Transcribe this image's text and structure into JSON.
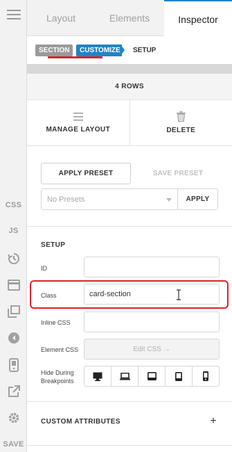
{
  "rail": {
    "css_label": "CSS",
    "js_label": "JS",
    "save_label": "SAVE"
  },
  "tabs": [
    {
      "label": "Layout",
      "active": false
    },
    {
      "label": "Elements",
      "active": false
    },
    {
      "label": "Inspector",
      "active": true
    }
  ],
  "breadcrumb": {
    "section": "SECTION",
    "customize": "CUSTOMIZE",
    "setup": "SETUP"
  },
  "rows_label": "4 ROWS",
  "actions": {
    "manage_layout": "MANAGE LAYOUT",
    "delete": "DELETE"
  },
  "presets": {
    "apply_preset": "APPLY PRESET",
    "save_preset": "SAVE PRESET",
    "select_value": "No Presets",
    "apply": "APPLY"
  },
  "setup": {
    "title": "SETUP",
    "id_label": "ID",
    "id_value": "",
    "class_label": "Class",
    "class_value": "card-section",
    "inline_css_label": "Inline CSS",
    "inline_css_value": "",
    "element_css_label": "Element CSS",
    "edit_css_button": "Edit CSS →",
    "hide_label_line1": "Hide During",
    "hide_label_line2": "Breakpoints"
  },
  "custom_attributes": {
    "title": "CUSTOM ATTRIBUTES",
    "add_symbol": "+"
  },
  "colors": {
    "accent": "#1f84c6",
    "highlight": "#e0202b"
  }
}
